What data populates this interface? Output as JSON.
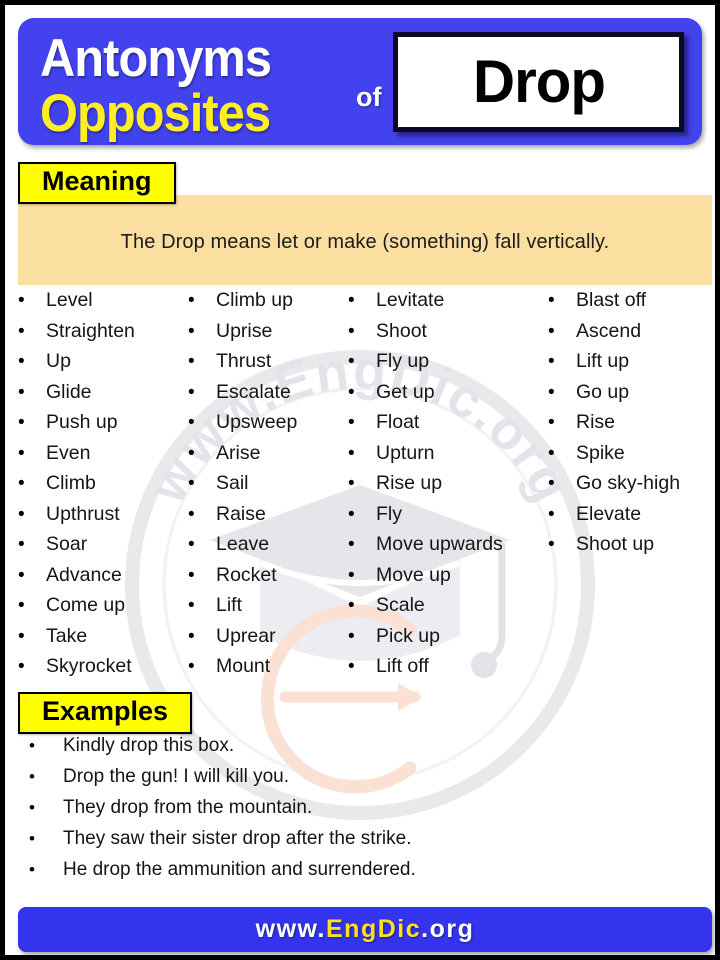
{
  "header": {
    "line1": "Antonyms",
    "line2": "Opposites",
    "connector": "of",
    "word": "Drop",
    "bg_color": "#4242EE",
    "line1_color": "#FFFFFF",
    "line2_color": "#FFEE22"
  },
  "meaning": {
    "label": "Meaning",
    "text": "The Drop means let or make (something) fall vertically.",
    "panel_color": "#FADFA0",
    "label_color": "#FFFF00"
  },
  "antonyms": {
    "columns": [
      {
        "items": [
          "Level",
          "Straighten",
          "Up",
          "Glide",
          "Push up",
          "Even",
          "Climb",
          "Upthrust",
          "Soar",
          "Advance",
          "Come up",
          "Take",
          "Skyrocket"
        ]
      },
      {
        "items": [
          "Climb up",
          "Uprise",
          "Thrust",
          "Escalate",
          "Upsweep",
          "Arise",
          "Sail",
          "Raise",
          "Leave",
          "Rocket",
          "Lift",
          "Uprear",
          "Mount"
        ]
      },
      {
        "items": [
          "Levitate",
          "Shoot",
          "Fly up",
          "Get up",
          "Float",
          "Upturn",
          "Rise up",
          "Fly",
          "Move upwards",
          "Move up",
          "Scale",
          "Pick up",
          "Lift off"
        ]
      },
      {
        "items": [
          "Blast off",
          "Ascend",
          "Lift up",
          "Go up",
          "Rise",
          "Spike",
          "Go sky-high",
          "Elevate",
          "Shoot up"
        ]
      }
    ],
    "bullet": "•"
  },
  "examples": {
    "label": "Examples",
    "items": [
      "Kindly drop this box.",
      "Drop the gun! I will kill you.",
      "They drop from the mountain.",
      "They saw their sister drop after the strike.",
      "He drop the ammunition and surrendered."
    ],
    "bullet": "•"
  },
  "footer": {
    "prefix": "www.",
    "brand": "EngDic",
    "suffix": ".org",
    "bg_color": "#3434EE",
    "brand_color": "#FFE11A"
  },
  "watermark": {
    "text": "www.EngDic.org"
  }
}
